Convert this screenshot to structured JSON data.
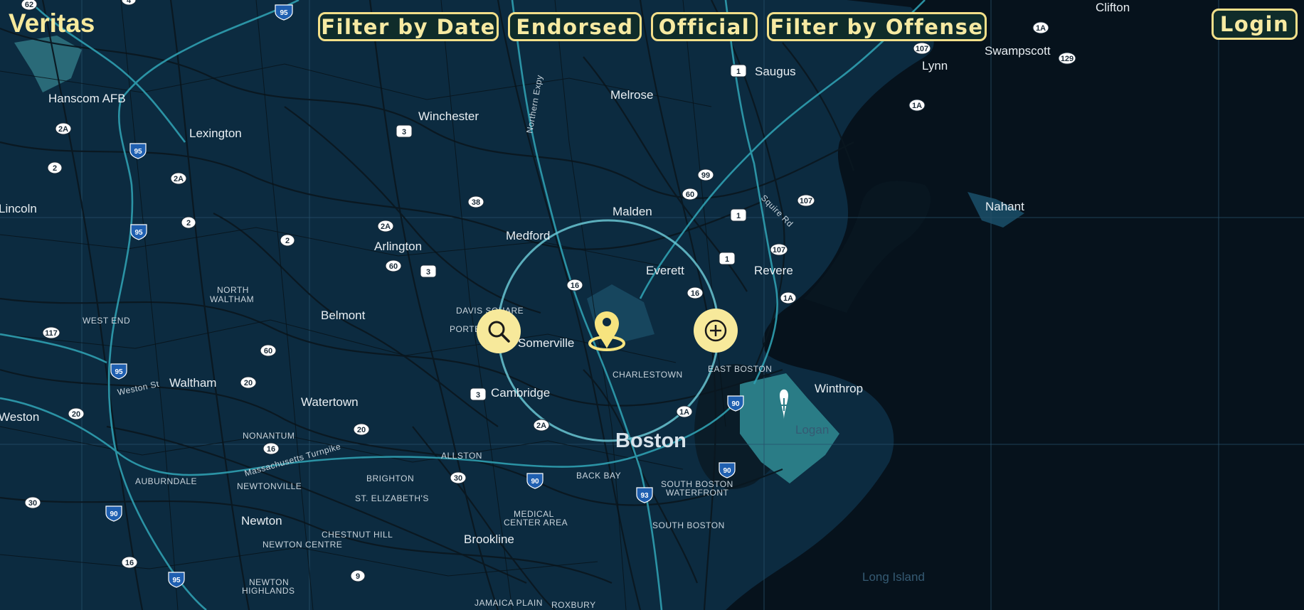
{
  "app": {
    "title": "Veritas"
  },
  "toolbar": {
    "filter_date": "Filter by Date",
    "endorsed": "Endorsed",
    "official": "Official",
    "filter_offense": "Filter by Offense"
  },
  "auth": {
    "login": "Login"
  },
  "map": {
    "actions": {
      "search_icon": "search-icon",
      "add_icon": "plus-circle-icon",
      "pin_icon": "location-pin-icon"
    },
    "places": {
      "veritas_hidden": "",
      "clifton": "Clifton",
      "hanscom": "Hanscom AFB",
      "lexington": "Lexington",
      "lincoln": "Lincoln",
      "winchester": "Winchester",
      "melrose": "Melrose",
      "saugus": "Saugus",
      "lynn": "Lynn",
      "swampscott": "Swampscott",
      "nahant": "Nahant",
      "malden": "Malden",
      "medford": "Medford",
      "arlington": "Arlington",
      "everett": "Everett",
      "revere": "Revere",
      "north_waltham": "NORTH",
      "north_waltham2": "WALTHAM",
      "belmont": "Belmont",
      "west_end": "WEST END",
      "davis_square": "DAVIS SQUARE",
      "porter": "PORTE",
      "somerville": "Somerville",
      "charlestown": "CHARLESTOWN",
      "east_boston": "EAST BOSTON",
      "winthrop": "Winthrop",
      "waltham": "Waltham",
      "watertown": "Watertown",
      "cambridge": "Cambridge",
      "weston": "Weston",
      "nonantum": "NONANTUM",
      "boston": "Boston",
      "allston": "ALLSTON",
      "auburndale": "AUBURNDALE",
      "newtonville": "NEWTONVILLE",
      "brighton": "BRIGHTON",
      "back_bay": "BACK BAY",
      "south_boston_waterfront": "SOUTH BOSTON",
      "south_boston_waterfront2": "WATERFRONT",
      "st_elizabeths": "ST. ELIZABETH'S",
      "medical": "MEDICAL",
      "medical2": "CENTER AREA",
      "south_boston": "SOUTH BOSTON",
      "newton": "Newton",
      "chestnut_hill": "CHESTNUT HILL",
      "brookline": "Brookline",
      "newton_centre": "NEWTON CENTRE",
      "newton_highlands": "NEWTON",
      "newton_highlands2": "HIGHLANDS",
      "jamaica_plain": "JAMAICA PLAIN",
      "roxbury": "ROXBURY",
      "long_island": "Long Island",
      "logan": "Logan",
      "weston_st": "Weston St",
      "mass_pike": "Massachusetts Turnpike",
      "squire_rd": "Squire Rd",
      "northern_expy": "Northern Expy"
    }
  }
}
